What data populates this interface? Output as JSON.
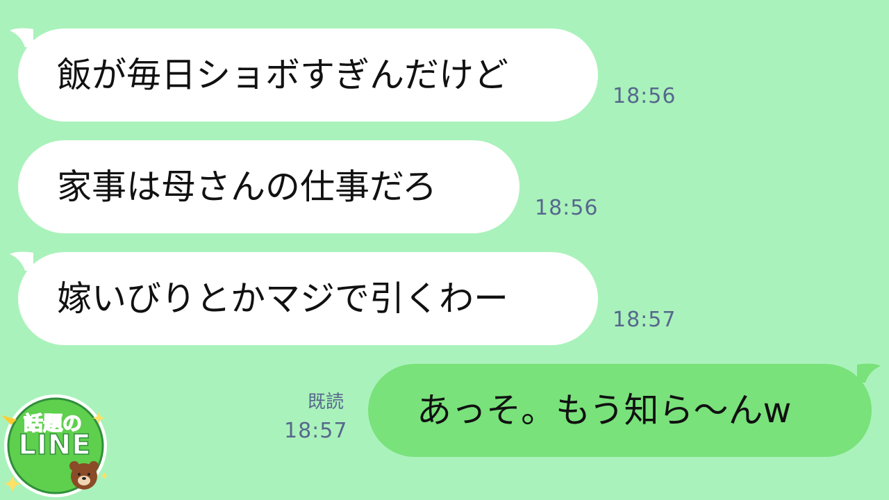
{
  "colors": {
    "background": "#aaf2bb",
    "incoming_bubble": "#ffffff",
    "outgoing_bubble": "#79e27b",
    "meta_text": "#56688c"
  },
  "messages": [
    {
      "direction": "incoming",
      "text": "飯が毎日ショボすぎんだけど",
      "time": "18:56"
    },
    {
      "direction": "incoming",
      "text": "家事は母さんの仕事だろ",
      "time": "18:56"
    },
    {
      "direction": "incoming",
      "text": "嫁いびりとかマジで引くわー",
      "time": "18:57"
    },
    {
      "direction": "outgoing",
      "text": "あっそ。もう知ら〜んw",
      "time": "18:57",
      "read_label": "既読"
    }
  ],
  "logo": {
    "title": "話題の",
    "line": "LINE",
    "icon": "bear-face-icon"
  }
}
